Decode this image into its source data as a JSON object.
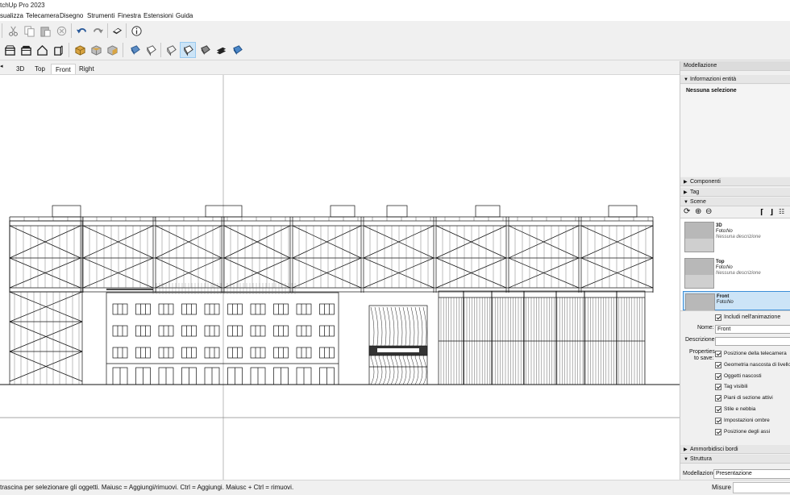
{
  "window": {
    "title": "tchUp Pro 2023"
  },
  "menu": [
    "sualizza",
    "Telecamera",
    "Disegno",
    "Strumenti",
    "Finestra",
    "Estensioni",
    "Guida"
  ],
  "scene_tabs": [
    "3D",
    "Top",
    "Front",
    "Right"
  ],
  "selected_tab": "Front",
  "status": {
    "text": "trascina per selezionare gli oggetti. Maiusc = Aggiungi/rimuovi. Ctrl = Aggiungi. Maiusc + Ctrl = rimuovi.",
    "measure_label": "Misure"
  },
  "panel": {
    "title": "Modellazione",
    "entity_info": {
      "header": "Informazioni entità",
      "selection": "Nessuna selezione"
    },
    "components_header": "Componenti",
    "tags_header": "Tag",
    "scenes_header": "Scene",
    "scenes": [
      {
        "name": "3D",
        "photo_label": "Foto:",
        "photo_value": "No",
        "desc": "Nessuna descrizione"
      },
      {
        "name": "Top",
        "photo_label": "Foto:",
        "photo_value": "No",
        "desc": "Nessuna descrizione"
      },
      {
        "name": "Front",
        "photo_label": "Foto:",
        "photo_value": "No",
        "desc": ""
      }
    ],
    "include_animation": "Includi nell'animazione",
    "name_label": "Nome:",
    "name_value": "Front",
    "description_label": "Descrizione:",
    "properties_label_1": "Properties",
    "properties_label_2": "to save:",
    "properties": [
      "Posizione della telecamera",
      "Geometria nascosta di livello su",
      "Oggetti nascosti",
      "Tag visibili",
      "Piani di sezione attivi",
      "Stile e nebbia",
      "Impostazioni ombre",
      "Posizione degli assi"
    ],
    "soften_header": "Ammorbidisci bordi",
    "structure_header": "Struttura",
    "structure_label": "Modellazione",
    "structure_value": "Presentazione"
  },
  "icons": [
    "cut-icon",
    "copy-icon",
    "paste-icon",
    "erase-icon",
    "undo-icon",
    "redo-icon",
    "print-icon",
    "info-icon",
    "iso-view-icon",
    "top-view-icon",
    "front-view-icon",
    "right-view-icon",
    "back-view-icon",
    "left-view-icon",
    "bottom-view-icon",
    "xray-icon",
    "back-edges-icon",
    "wireframe-icon",
    "hidden-line-icon",
    "shaded-icon",
    "shaded-textures-icon",
    "monochrome-icon"
  ]
}
